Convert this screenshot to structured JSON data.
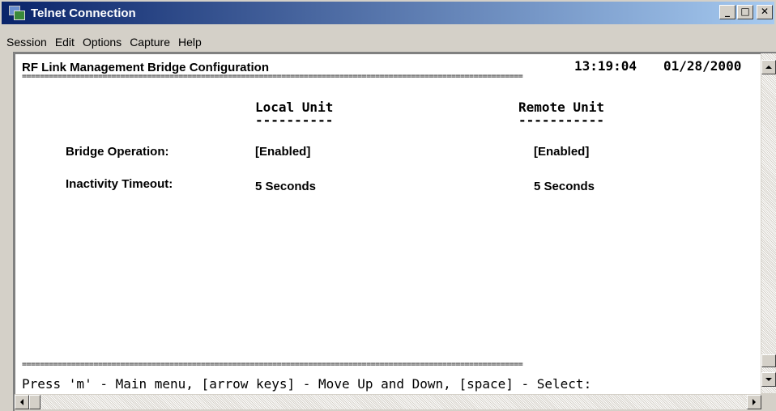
{
  "window": {
    "title": "Telnet Connection",
    "icon": "telnet-app-icon",
    "buttons": {
      "minimize": "_",
      "maximize": "□",
      "close": "✕"
    }
  },
  "menu": [
    "Session",
    "Edit",
    "Options",
    "Capture",
    "Help"
  ],
  "terminal": {
    "header_title": "RF Link Management Bridge Configuration",
    "time": "13:19:04",
    "date": "01/28/2000",
    "separator": "================================================================================================================",
    "local_unit_heading": "Local Unit",
    "local_unit_underline": "----------",
    "remote_unit_heading": "Remote Unit",
    "remote_unit_underline": "-----------",
    "rows": [
      {
        "label": "Bridge Operation:",
        "local": "[Enabled]",
        "remote": "[Enabled]"
      },
      {
        "label": "Inactivity Timeout:",
        "local": "5 Seconds",
        "remote": "5 Seconds"
      }
    ],
    "footer_separator": "================================================================================================================",
    "footer_help": "Press 'm' - Main menu, [arrow keys] - Move Up and Down, [space] - Select:"
  }
}
